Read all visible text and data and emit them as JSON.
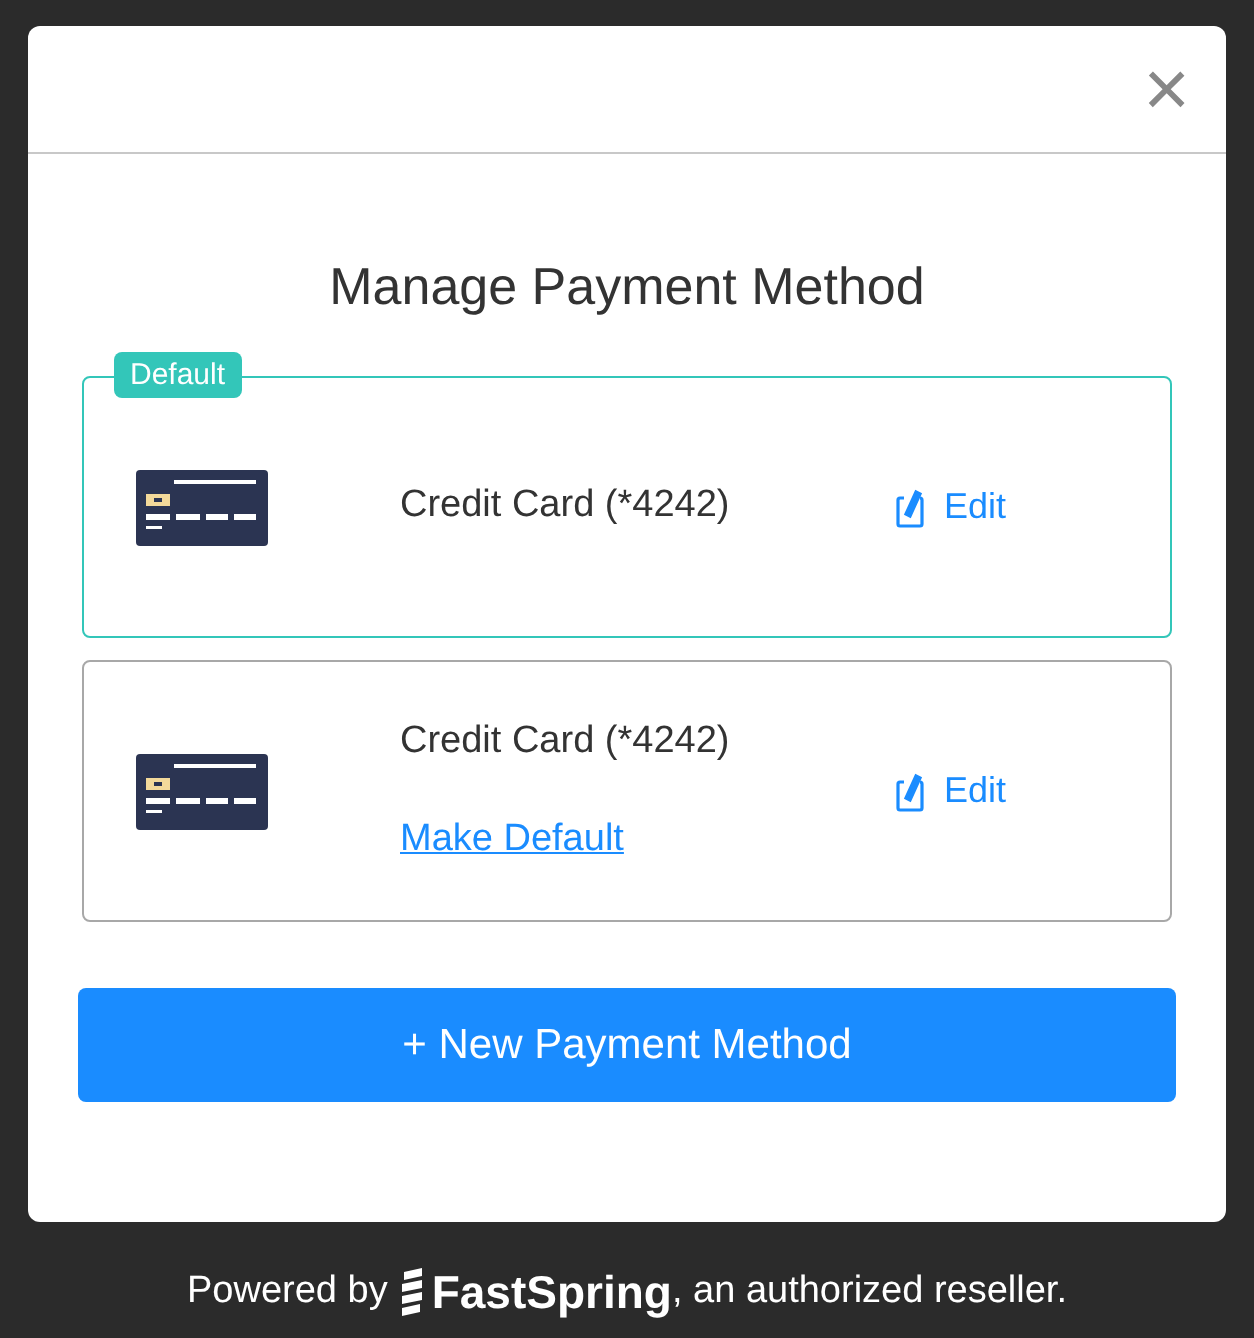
{
  "dialog": {
    "title": "Manage Payment Method",
    "close": "×"
  },
  "methods": [
    {
      "label": "Credit Card (*4242)",
      "is_default": true,
      "badge": "Default",
      "edit": "Edit"
    },
    {
      "label": "Credit Card (*4242)",
      "is_default": false,
      "make_default": "Make Default",
      "edit": "Edit"
    }
  ],
  "new_button": "+ New Payment Method",
  "footer": {
    "before": "Powered by",
    "brand": "FastSpring",
    "after": ", an authorized reseller."
  }
}
